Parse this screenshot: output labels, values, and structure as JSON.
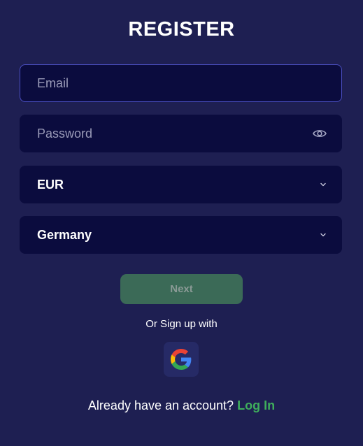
{
  "form": {
    "title": "REGISTER",
    "email": {
      "value": "",
      "placeholder": "Email",
      "icon": "none"
    },
    "password": {
      "value": "",
      "placeholder": "Password",
      "icon": "eye-icon"
    },
    "currency": {
      "selected": "EUR",
      "icon": "chevron-down-icon"
    },
    "country": {
      "selected": "Germany",
      "icon": "chevron-down-icon"
    },
    "next_label": "Next",
    "or_signup_label": "Or Sign up with",
    "social": [
      {
        "provider": "google",
        "icon": "google-icon"
      }
    ],
    "footer_text": "Already have an account?",
    "login_label": "Log In"
  },
  "colors": {
    "background": "#1e1f52",
    "input_background": "#0b0c3e",
    "focus_border": "#4b4fc2",
    "next_button": "#3b6a57",
    "link": "#3fae5c"
  }
}
